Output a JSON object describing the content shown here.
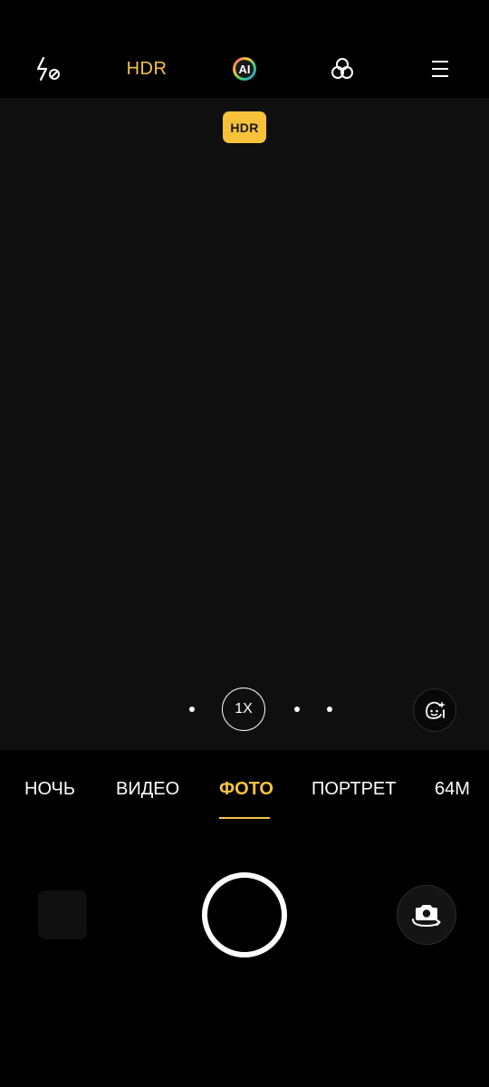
{
  "top_bar": {
    "flash_icon": "flash-off-icon",
    "hdr_label": "HDR",
    "ai_label": "AI",
    "filter_icon": "filter-icon",
    "menu_icon": "menu-icon"
  },
  "viewfinder": {
    "hdr_badge": "HDR"
  },
  "zoom": {
    "current": "1X"
  },
  "modes": [
    {
      "label": "НОЧЬ"
    },
    {
      "label": "ВИДЕО"
    },
    {
      "label": "ФОТО",
      "active": true
    },
    {
      "label": "ПОРТРЕТ"
    },
    {
      "label": "64М"
    }
  ],
  "colors": {
    "accent": "#f6c343",
    "badge": "#f7c23a",
    "background": "#000000",
    "viewfinder": "#0f0f10"
  }
}
